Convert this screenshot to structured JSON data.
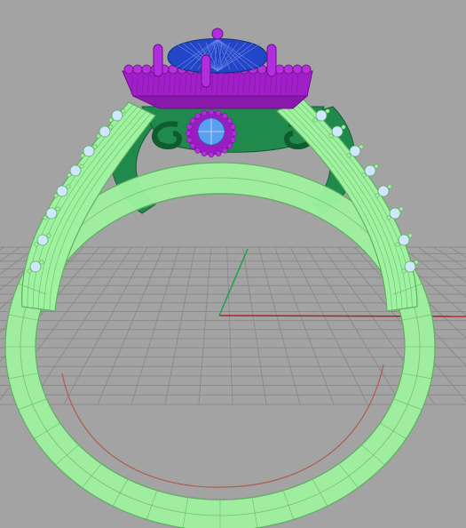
{
  "viewport": {
    "background": "#a3a3a3",
    "grid_color": "#8b8b8b",
    "grid_major_color": "#7a7a7a",
    "x_axis_color": "#b0202a",
    "y_axis_color": "#1ea14b"
  },
  "model": {
    "shank_color": "#9ff2a0",
    "shank_edge_color": "#5fae62",
    "gallery_color": "#1f8a4b",
    "head_color": "#a11fc9",
    "head_edge_color": "#6b1287",
    "center_stone_color": "#2346c8",
    "accent_stone_color": "#5b9ff0",
    "side_stone_color": "#cfe8ff"
  }
}
